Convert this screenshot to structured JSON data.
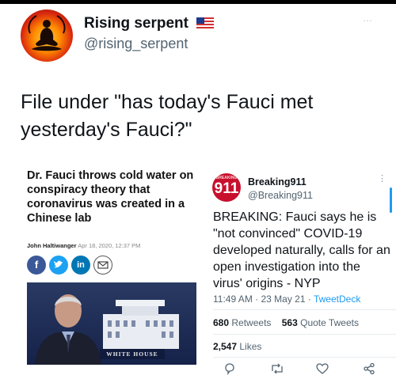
{
  "tweet": {
    "display_name": "Rising serpent",
    "handle": "@rising_serpent",
    "more_icon": "⋯",
    "text": "File under \"has today's Fauci met yesterday's Fauci?\""
  },
  "article": {
    "headline": "Dr. Fauci throws cold water on conspiracy theory that coronavirus was created in a Chinese lab",
    "author": "John Haltiwanger",
    "date": "Apr 18, 2020, 12:37 PM",
    "share_icons": [
      "facebook-icon",
      "twitter-icon",
      "linkedin-icon",
      "email-icon"
    ],
    "photo_sign": "WHITE HOUSE"
  },
  "inner_tweet": {
    "avatar_text": "911",
    "avatar_subtext": "BREAKING",
    "name": "Breaking911",
    "handle": "@Breaking911",
    "more_icon": "⋮",
    "text": "BREAKING: Fauci says he is \"not convinced\" COVID-19 developed naturally, calls for an open investigation into the virus' origins - NYP",
    "time": "11:49 AM · 23 May 21 · ",
    "source": "TweetDeck",
    "retweets_count": "680",
    "retweets_label": "Retweets",
    "quotes_count": "563",
    "quotes_label": "Quote Tweets",
    "likes_count": "2,547",
    "likes_label": "Likes"
  },
  "colors": {
    "link_blue": "#1d9bf0",
    "secondary_text": "#536471",
    "facebook": "#3b5998",
    "twitter": "#1da1f2",
    "linkedin": "#0077b5"
  }
}
